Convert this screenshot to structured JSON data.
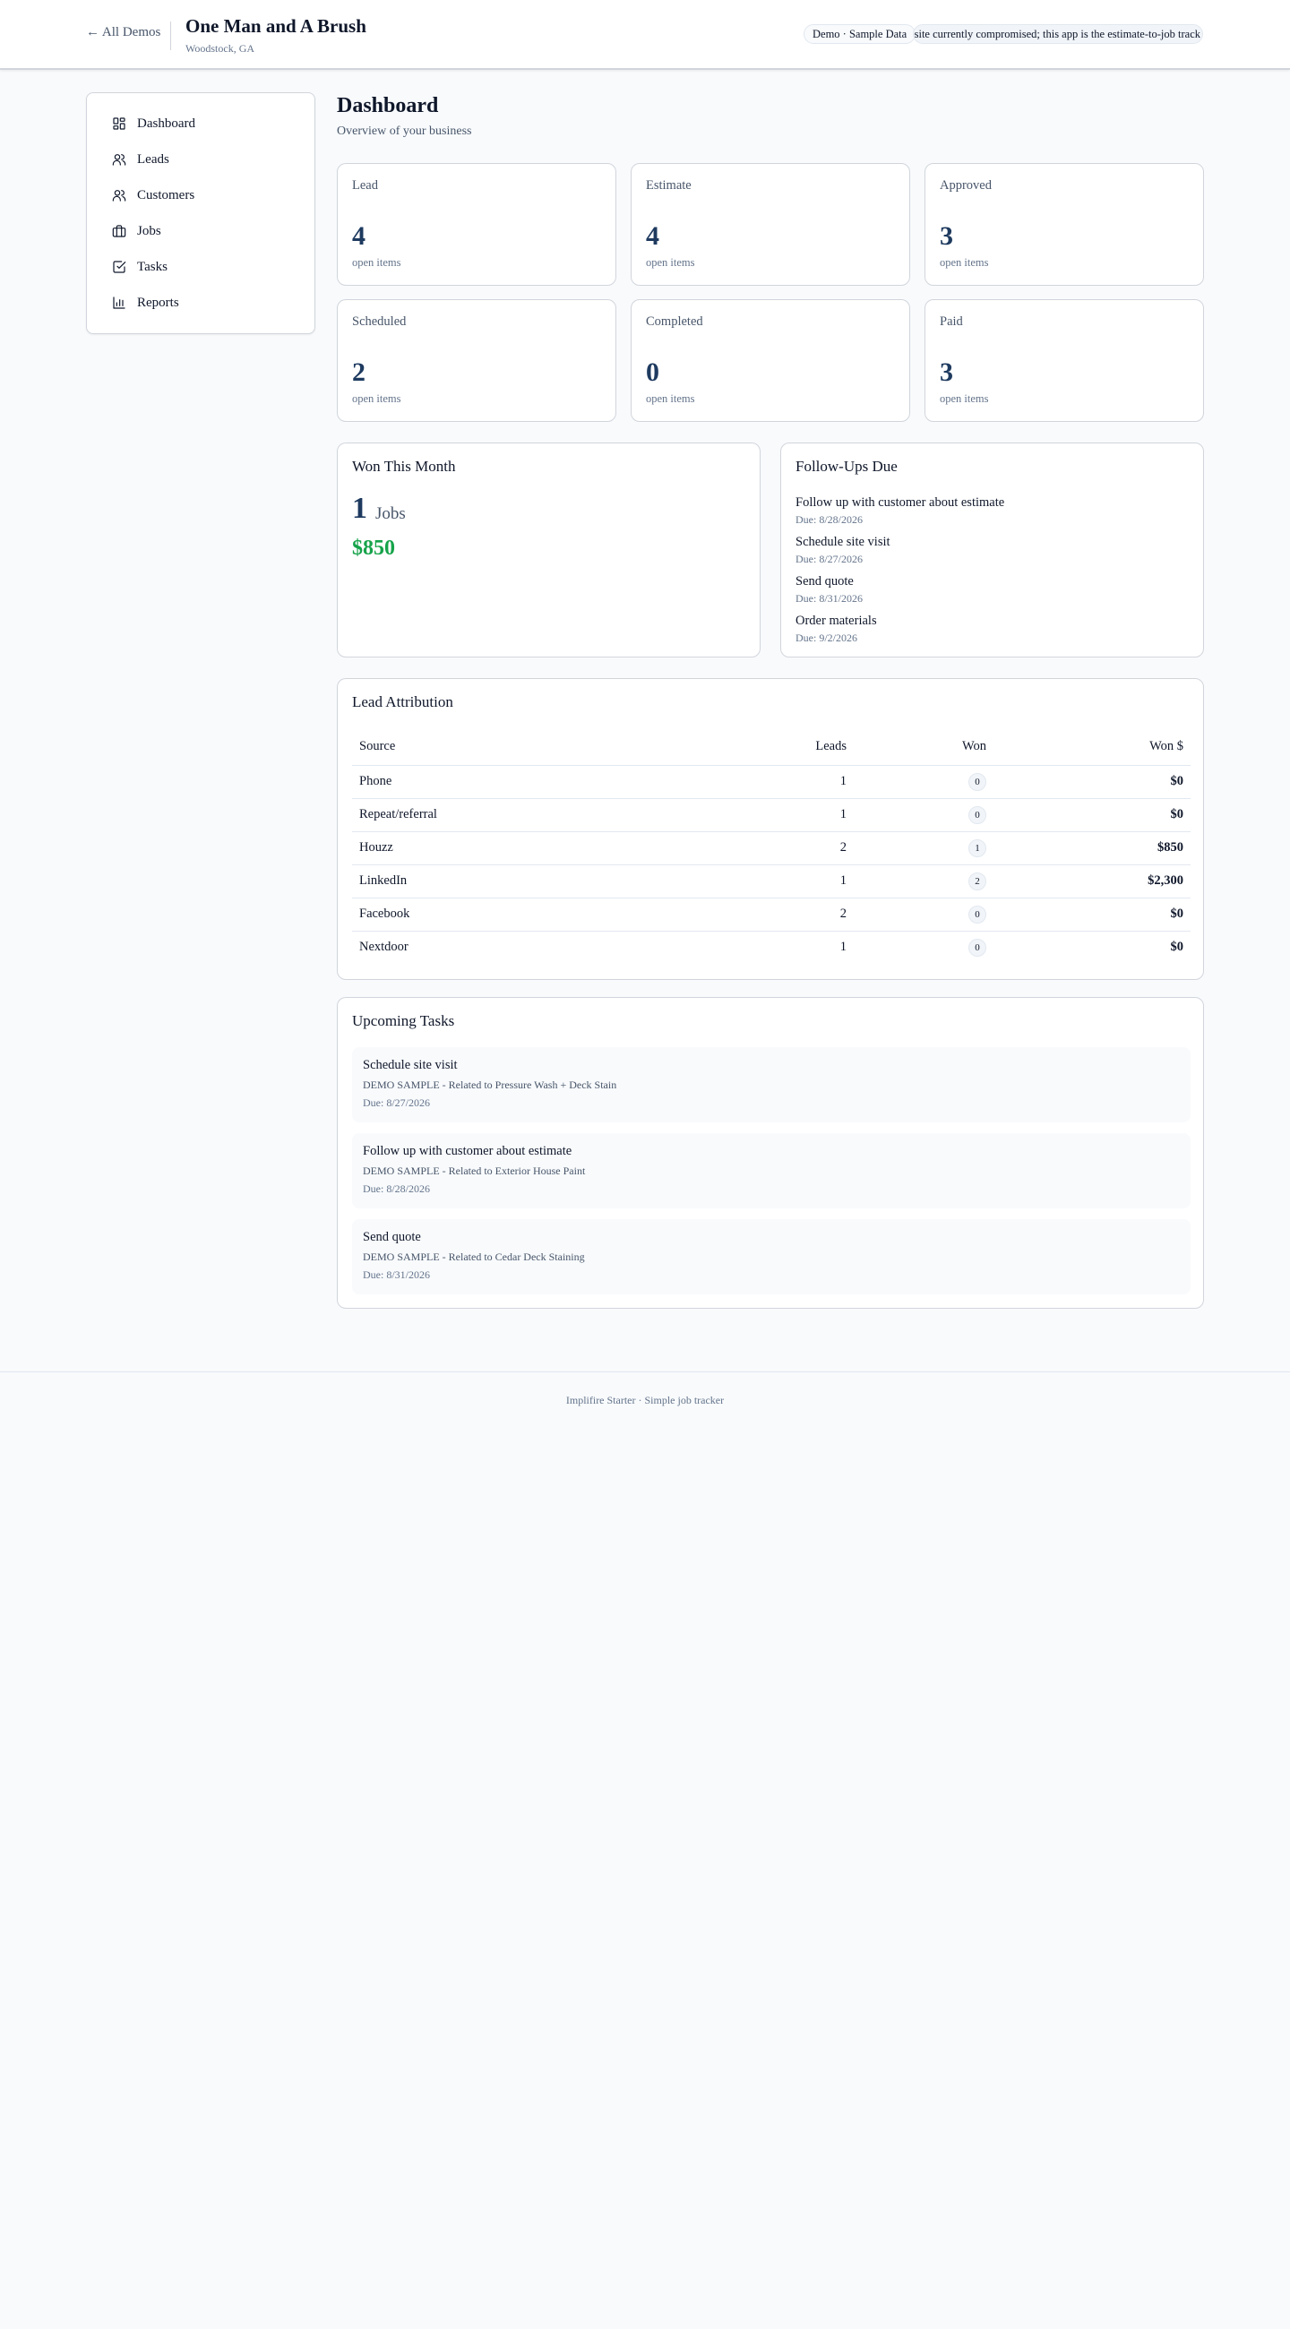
{
  "header": {
    "back_label": "← All Demos",
    "title": "One Man and A Brush",
    "location": "Woodstock, GA",
    "demo_badge": "Demo · Sample Data",
    "notice": "ebsite currently compromised; this app is the estimate-to-job track"
  },
  "sidebar": {
    "items": [
      {
        "label": "Dashboard",
        "icon": "dashboard-icon"
      },
      {
        "label": "Leads",
        "icon": "users-icon"
      },
      {
        "label": "Customers",
        "icon": "users-icon"
      },
      {
        "label": "Jobs",
        "icon": "briefcase-icon"
      },
      {
        "label": "Tasks",
        "icon": "check-square-icon"
      },
      {
        "label": "Reports",
        "icon": "bar-chart-icon"
      }
    ]
  },
  "page": {
    "title": "Dashboard",
    "subtitle": "Overview of your business"
  },
  "stats": [
    {
      "label": "Lead",
      "value": "4",
      "foot": "open items"
    },
    {
      "label": "Estimate",
      "value": "4",
      "foot": "open items"
    },
    {
      "label": "Approved",
      "value": "3",
      "foot": "open items"
    },
    {
      "label": "Scheduled",
      "value": "2",
      "foot": "open items"
    },
    {
      "label": "Completed",
      "value": "0",
      "foot": "open items"
    },
    {
      "label": "Paid",
      "value": "3",
      "foot": "open items"
    }
  ],
  "won_this_month": {
    "title": "Won This Month",
    "count": "1",
    "unit": "Jobs",
    "amount": "$850"
  },
  "follow_ups": {
    "title": "Follow-Ups Due",
    "items": [
      {
        "title": "Follow up with customer about estimate",
        "due": "Due: 8/28/2026"
      },
      {
        "title": "Schedule site visit",
        "due": "Due: 8/27/2026"
      },
      {
        "title": "Send quote",
        "due": "Due: 8/31/2026"
      },
      {
        "title": "Order materials",
        "due": "Due: 9/2/2026"
      }
    ]
  },
  "lead_attribution": {
    "title": "Lead Attribution",
    "columns": [
      "Source",
      "Leads",
      "Won",
      "Won $"
    ],
    "rows": [
      {
        "source": "Phone",
        "leads": "1",
        "won": "0",
        "won_amount": "$0"
      },
      {
        "source": "Repeat/referral",
        "leads": "1",
        "won": "0",
        "won_amount": "$0"
      },
      {
        "source": "Houzz",
        "leads": "2",
        "won": "1",
        "won_amount": "$850"
      },
      {
        "source": "LinkedIn",
        "leads": "1",
        "won": "2",
        "won_amount": "$2,300"
      },
      {
        "source": "Facebook",
        "leads": "2",
        "won": "0",
        "won_amount": "$0"
      },
      {
        "source": "Nextdoor",
        "leads": "1",
        "won": "0",
        "won_amount": "$0"
      }
    ]
  },
  "upcoming_tasks": {
    "title": "Upcoming Tasks",
    "items": [
      {
        "title": "Schedule site visit",
        "related": "DEMO SAMPLE - Related to Pressure Wash + Deck Stain",
        "due": "Due: 8/27/2026"
      },
      {
        "title": "Follow up with customer about estimate",
        "related": "DEMO SAMPLE - Related to Exterior House Paint",
        "due": "Due: 8/28/2026"
      },
      {
        "title": "Send quote",
        "related": "DEMO SAMPLE - Related to Cedar Deck Staining",
        "due": "Due: 8/31/2026"
      }
    ]
  },
  "footer": {
    "text": "Implifire Starter · Simple job tracker"
  }
}
